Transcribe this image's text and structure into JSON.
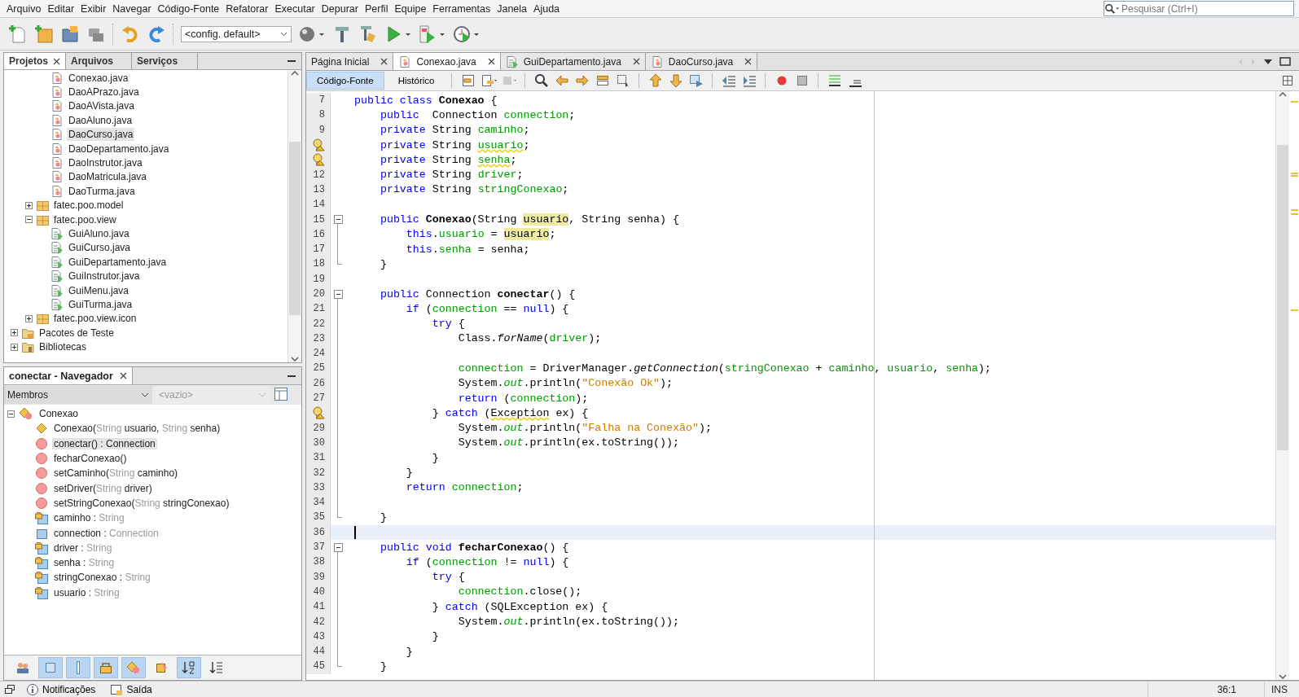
{
  "menu": [
    "Arquivo",
    "Editar",
    "Exibir",
    "Navegar",
    "Código-Fonte",
    "Refatorar",
    "Executar",
    "Depurar",
    "Perfil",
    "Equipe",
    "Ferramentas",
    "Janela",
    "Ajuda"
  ],
  "search": {
    "placeholder": "Pesquisar (Ctrl+I)"
  },
  "toolbar": {
    "configuration": "<config. default>"
  },
  "projects": {
    "tabs": [
      {
        "label": "Projetos",
        "selected": true
      },
      {
        "label": "Arquivos",
        "selected": false
      },
      {
        "label": "Serviços",
        "selected": false
      }
    ],
    "tree": [
      {
        "children": [
          {
            "children": [
              {
                "children": [
                  {
                    "label": "Conexao.java",
                    "kind": "class",
                    "selected": false
                  },
                  {
                    "label": "DaoAPrazo.java",
                    "kind": "class",
                    "selected": false
                  },
                  {
                    "label": "DaoAVista.java",
                    "kind": "class",
                    "selected": false
                  },
                  {
                    "label": "DaoAluno.java",
                    "kind": "class",
                    "selected": false
                  },
                  {
                    "label": "DaoCurso.java",
                    "kind": "class",
                    "selected": true
                  },
                  {
                    "label": "DaoDepartamento.java",
                    "kind": "class",
                    "selected": false
                  },
                  {
                    "label": "DaoInstrutor.java",
                    "kind": "class",
                    "selected": false
                  },
                  {
                    "label": "DaoMatricula.java",
                    "kind": "class",
                    "selected": false
                  },
                  {
                    "label": "DaoTurma.java",
                    "kind": "class",
                    "selected": false
                  }
                ]
              },
              {
                "label": "fatec.poo.model",
                "kind": "package",
                "expanded": false,
                "selected": false
              },
              {
                "label": "fatec.poo.view",
                "kind": "package",
                "expanded": true,
                "selected": false,
                "children": [
                  {
                    "label": "GuiAluno.java",
                    "kind": "form",
                    "selected": false
                  },
                  {
                    "label": "GuiCurso.java",
                    "kind": "form",
                    "selected": false
                  },
                  {
                    "label": "GuiDepartamento.java",
                    "kind": "form",
                    "selected": false
                  },
                  {
                    "label": "GuiInstrutor.java",
                    "kind": "form",
                    "selected": false
                  },
                  {
                    "label": "GuiMenu.java",
                    "kind": "form",
                    "selected": false
                  },
                  {
                    "label": "GuiTurma.java",
                    "kind": "form",
                    "selected": false
                  }
                ]
              },
              {
                "label": "fatec.poo.view.icon",
                "kind": "package",
                "expanded": false,
                "selected": false
              }
            ]
          },
          {
            "label": "Pacotes de Teste",
            "kind": "folder",
            "expanded": false,
            "selected": false
          },
          {
            "label": "Bibliotecas",
            "kind": "library",
            "expanded": false,
            "selected": false
          }
        ]
      }
    ]
  },
  "navigator": {
    "title": "conectar - Navegador",
    "view": "Membros",
    "filter_placeholder": "<vazio>",
    "root": {
      "label": "Conexao",
      "expanded": true,
      "members": [
        {
          "kind": "constructor",
          "selected": false,
          "segments": [
            {
              "kind": "name",
              "text": "Conexao("
            },
            {
              "kind": "type",
              "text": "String"
            },
            {
              "kind": "name",
              "text": " usuario, "
            },
            {
              "kind": "type",
              "text": "String"
            },
            {
              "kind": "name",
              "text": " senha)"
            }
          ]
        },
        {
          "kind": "method",
          "selected": true,
          "segments": [
            {
              "kind": "name",
              "text": "conectar() : Connection"
            }
          ]
        },
        {
          "kind": "method",
          "selected": false,
          "segments": [
            {
              "kind": "name",
              "text": "fecharConexao()"
            }
          ]
        },
        {
          "kind": "method",
          "selected": false,
          "segments": [
            {
              "kind": "name",
              "text": "setCaminho("
            },
            {
              "kind": "type",
              "text": "String"
            },
            {
              "kind": "name",
              "text": " caminho)"
            }
          ]
        },
        {
          "kind": "method",
          "selected": false,
          "segments": [
            {
              "kind": "name",
              "text": "setDriver("
            },
            {
              "kind": "type",
              "text": "String"
            },
            {
              "kind": "name",
              "text": " driver)"
            }
          ]
        },
        {
          "kind": "method",
          "selected": false,
          "segments": [
            {
              "kind": "name",
              "text": "setStringConexao("
            },
            {
              "kind": "type",
              "text": "String"
            },
            {
              "kind": "name",
              "text": " stringConexao)"
            }
          ]
        },
        {
          "kind": "private_field",
          "selected": false,
          "segments": [
            {
              "kind": "name",
              "text": "caminho : "
            },
            {
              "kind": "type",
              "text": "String"
            }
          ]
        },
        {
          "kind": "field",
          "selected": false,
          "segments": [
            {
              "kind": "name",
              "text": "connection : "
            },
            {
              "kind": "type",
              "text": "Connection"
            }
          ]
        },
        {
          "kind": "private_field",
          "selected": false,
          "segments": [
            {
              "kind": "name",
              "text": "driver : "
            },
            {
              "kind": "type",
              "text": "String"
            }
          ]
        },
        {
          "kind": "private_field",
          "selected": false,
          "segments": [
            {
              "kind": "name",
              "text": "senha : "
            },
            {
              "kind": "type",
              "text": "String"
            }
          ]
        },
        {
          "kind": "private_field",
          "selected": false,
          "segments": [
            {
              "kind": "name",
              "text": "stringConexao : "
            },
            {
              "kind": "type",
              "text": "String"
            }
          ]
        },
        {
          "kind": "private_field",
          "selected": false,
          "segments": [
            {
              "kind": "name",
              "text": "usuario : "
            },
            {
              "kind": "type",
              "text": "String"
            }
          ]
        }
      ]
    },
    "filters": [
      {
        "kind": "inherited",
        "selected": false
      },
      {
        "kind": "fields",
        "selected": true
      },
      {
        "kind": "static",
        "selected": true
      },
      {
        "kind": "nonpublic",
        "selected": true
      },
      {
        "kind": "inner",
        "selected": true
      },
      {
        "kind": "javadoc",
        "selected": false
      },
      {
        "kind": "sort_name",
        "selected": true
      },
      {
        "kind": "sort_source",
        "selected": false
      }
    ]
  },
  "editor": {
    "tabs": [
      {
        "label": "Página Inicial",
        "kind": "page",
        "selected": false
      },
      {
        "label": "Conexao.java",
        "kind": "class",
        "selected": true
      },
      {
        "label": "GuiDepartamento.java",
        "kind": "form",
        "selected": false
      },
      {
        "label": "DaoCurso.java",
        "kind": "class",
        "selected": false
      }
    ],
    "views": [
      {
        "label": "Código-Fonte",
        "selected": true
      },
      {
        "label": "Histórico",
        "selected": false
      }
    ],
    "lines": [
      {
        "number": "7",
        "kind": "plain",
        "warning": false,
        "current": false,
        "tokens": [
          {
            "kind": "kw",
            "text": "public class "
          },
          {
            "kind": "decl",
            "text": "Conexao"
          },
          {
            "kind": "plain",
            "text": " {"
          }
        ]
      },
      {
        "number": "8",
        "kind": "plain",
        "warning": false,
        "current": false,
        "tokens": [
          {
            "kind": "kw",
            "text": "    public "
          },
          {
            "kind": "plain",
            "text": " Connection "
          },
          {
            "kind": "field",
            "text": "connection"
          },
          {
            "kind": "plain",
            "text": ";"
          }
        ]
      },
      {
        "number": "9",
        "kind": "plain",
        "warning": false,
        "current": false,
        "tokens": [
          {
            "kind": "kw",
            "text": "    private "
          },
          {
            "kind": "plain",
            "text": "String "
          },
          {
            "kind": "field",
            "text": "caminho"
          },
          {
            "kind": "plain",
            "text": ";"
          }
        ]
      },
      {
        "kind": "plain",
        "warning": true,
        "current": false,
        "tokens": [
          {
            "kind": "kw",
            "text": "    private "
          },
          {
            "kind": "plain",
            "text": "String "
          },
          {
            "kind": "warn",
            "text": "usuario"
          },
          {
            "kind": "plain",
            "text": ";"
          }
        ]
      },
      {
        "kind": "plain",
        "warning": true,
        "current": false,
        "tokens": [
          {
            "kind": "kw",
            "text": "    private "
          },
          {
            "kind": "plain",
            "text": "String "
          },
          {
            "kind": "warn",
            "text": "senha"
          },
          {
            "kind": "plain",
            "text": ";"
          }
        ]
      },
      {
        "number": "12",
        "kind": "plain",
        "warning": false,
        "current": false,
        "tokens": [
          {
            "kind": "kw",
            "text": "    private "
          },
          {
            "kind": "plain",
            "text": "String "
          },
          {
            "kind": "field",
            "text": "driver"
          },
          {
            "kind": "plain",
            "text": ";"
          }
        ]
      },
      {
        "number": "13",
        "kind": "plain",
        "warning": false,
        "current": false,
        "tokens": [
          {
            "kind": "kw",
            "text": "    private "
          },
          {
            "kind": "plain",
            "text": "String "
          },
          {
            "kind": "field",
            "text": "stringConexao"
          },
          {
            "kind": "plain",
            "text": ";"
          }
        ]
      },
      {
        "number": "14",
        "kind": "plain",
        "warning": false,
        "current": false
      },
      {
        "number": "15",
        "kind": "fold_start",
        "warning": false,
        "current": false,
        "tokens": [
          {
            "kind": "kw",
            "text": "    public "
          },
          {
            "kind": "decl",
            "text": "Conexao"
          },
          {
            "kind": "plain",
            "text": "(String "
          },
          {
            "kind": "occurrence",
            "text": "usuario"
          },
          {
            "kind": "plain",
            "text": ", String senha) {"
          }
        ]
      },
      {
        "number": "16",
        "kind": "fold_body",
        "warning": false,
        "current": false,
        "tokens": [
          {
            "kind": "kw",
            "text": "        this"
          },
          {
            "kind": "plain",
            "text": "."
          },
          {
            "kind": "field",
            "text": "usuario"
          },
          {
            "kind": "plain",
            "text": " = "
          },
          {
            "kind": "occurrence",
            "text": "usuario"
          },
          {
            "kind": "plain",
            "text": ";"
          }
        ]
      },
      {
        "number": "17",
        "kind": "fold_body",
        "warning": false,
        "current": false,
        "tokens": [
          {
            "kind": "kw",
            "text": "        this"
          },
          {
            "kind": "plain",
            "text": "."
          },
          {
            "kind": "field",
            "text": "senha"
          },
          {
            "kind": "plain",
            "text": " = senha;"
          }
        ]
      },
      {
        "number": "18",
        "kind": "fold_end",
        "warning": false,
        "current": false,
        "tokens": [
          {
            "kind": "plain",
            "text": "    }"
          }
        ]
      },
      {
        "number": "19",
        "kind": "plain",
        "warning": false,
        "current": false
      },
      {
        "number": "20",
        "kind": "fold_start",
        "warning": false,
        "current": false,
        "tokens": [
          {
            "kind": "kw",
            "text": "    public "
          },
          {
            "kind": "plain",
            "text": "Connection "
          },
          {
            "kind": "decl",
            "text": "conectar"
          },
          {
            "kind": "plain",
            "text": "() {"
          }
        ]
      },
      {
        "number": "21",
        "kind": "fold_body",
        "warning": false,
        "current": false,
        "tokens": [
          {
            "kind": "kw",
            "text": "        if"
          },
          {
            "kind": "plain",
            "text": " ("
          },
          {
            "kind": "field",
            "text": "connection"
          },
          {
            "kind": "plain",
            "text": " == "
          },
          {
            "kind": "kw",
            "text": "null"
          },
          {
            "kind": "plain",
            "text": ") {"
          }
        ]
      },
      {
        "number": "22",
        "kind": "fold_body",
        "warning": false,
        "current": false,
        "tokens": [
          {
            "kind": "kw",
            "text": "            try"
          },
          {
            "kind": "plain",
            "text": " {"
          }
        ]
      },
      {
        "number": "23",
        "kind": "fold_body",
        "warning": false,
        "current": false,
        "tokens": [
          {
            "kind": "plain",
            "text": "                Class."
          },
          {
            "kind": "call",
            "text": "forName"
          },
          {
            "kind": "plain",
            "text": "("
          },
          {
            "kind": "field",
            "text": "driver"
          },
          {
            "kind": "plain",
            "text": ");"
          }
        ]
      },
      {
        "number": "24",
        "kind": "fold_body",
        "warning": false,
        "current": false
      },
      {
        "number": "25",
        "kind": "fold_body",
        "warning": false,
        "current": false,
        "tokens": [
          {
            "kind": "field",
            "text": "                connection"
          },
          {
            "kind": "plain",
            "text": " = DriverManager."
          },
          {
            "kind": "call",
            "text": "getConnection"
          },
          {
            "kind": "plain",
            "text": "("
          },
          {
            "kind": "field",
            "text": "stringConexao"
          },
          {
            "kind": "plain",
            "text": " + "
          },
          {
            "kind": "field",
            "text": "caminho"
          },
          {
            "kind": "plain",
            "text": ", "
          },
          {
            "kind": "field",
            "text": "usuario"
          },
          {
            "kind": "plain",
            "text": ", "
          },
          {
            "kind": "field",
            "text": "senha"
          },
          {
            "kind": "plain",
            "text": ");"
          }
        ]
      },
      {
        "number": "26",
        "kind": "fold_body",
        "warning": false,
        "current": false,
        "tokens": [
          {
            "kind": "plain",
            "text": "                System."
          },
          {
            "kind": "static",
            "text": "out"
          },
          {
            "kind": "plain",
            "text": ".println("
          },
          {
            "kind": "string",
            "text": "\"Conexão Ok\""
          },
          {
            "kind": "plain",
            "text": ");"
          }
        ]
      },
      {
        "number": "27",
        "kind": "fold_body",
        "warning": false,
        "current": false,
        "tokens": [
          {
            "kind": "kw",
            "text": "                return"
          },
          {
            "kind": "plain",
            "text": " ("
          },
          {
            "kind": "field",
            "text": "connection"
          },
          {
            "kind": "plain",
            "text": ");"
          }
        ]
      },
      {
        "kind": "fold_body",
        "warning": true,
        "current": false,
        "tokens": [
          {
            "kind": "plain",
            "text": "            } "
          },
          {
            "kind": "kw",
            "text": "catch"
          },
          {
            "kind": "plain",
            "text": " ("
          },
          {
            "kind": "warn",
            "text": "Exception"
          },
          {
            "kind": "plain",
            "text": " ex) {"
          }
        ]
      },
      {
        "number": "29",
        "kind": "fold_body",
        "warning": false,
        "current": false,
        "tokens": [
          {
            "kind": "plain",
            "text": "                System."
          },
          {
            "kind": "static",
            "text": "out"
          },
          {
            "kind": "plain",
            "text": ".println("
          },
          {
            "kind": "string",
            "text": "\"Falha na Conexão\""
          },
          {
            "kind": "plain",
            "text": ");"
          }
        ]
      },
      {
        "number": "30",
        "kind": "fold_body",
        "warning": false,
        "current": false,
        "tokens": [
          {
            "kind": "plain",
            "text": "                System."
          },
          {
            "kind": "static",
            "text": "out"
          },
          {
            "kind": "plain",
            "text": ".println(ex.toString());"
          }
        ]
      },
      {
        "number": "31",
        "kind": "fold_body",
        "warning": false,
        "current": false,
        "tokens": [
          {
            "kind": "plain",
            "text": "            }"
          }
        ]
      },
      {
        "number": "32",
        "kind": "fold_body",
        "warning": false,
        "current": false,
        "tokens": [
          {
            "kind": "plain",
            "text": "        }"
          }
        ]
      },
      {
        "number": "33",
        "kind": "fold_body",
        "warning": false,
        "current": false,
        "tokens": [
          {
            "kind": "kw",
            "text": "        return "
          },
          {
            "kind": "field",
            "text": "connection"
          },
          {
            "kind": "plain",
            "text": ";"
          }
        ]
      },
      {
        "number": "34",
        "kind": "fold_body",
        "warning": false,
        "current": false
      },
      {
        "number": "35",
        "kind": "fold_end",
        "warning": false,
        "current": false,
        "tokens": [
          {
            "kind": "plain",
            "text": "    }"
          }
        ]
      },
      {
        "number": "36",
        "kind": "plain",
        "warning": false,
        "current": true
      },
      {
        "number": "37",
        "kind": "fold_start",
        "warning": false,
        "current": false,
        "tokens": [
          {
            "kind": "kw",
            "text": "    public void "
          },
          {
            "kind": "decl",
            "text": "fecharConexao"
          },
          {
            "kind": "plain",
            "text": "() {"
          }
        ]
      },
      {
        "number": "38",
        "kind": "fold_body",
        "warning": false,
        "current": false,
        "tokens": [
          {
            "kind": "kw",
            "text": "        if"
          },
          {
            "kind": "plain",
            "text": " ("
          },
          {
            "kind": "field",
            "text": "connection"
          },
          {
            "kind": "plain",
            "text": " != "
          },
          {
            "kind": "kw",
            "text": "null"
          },
          {
            "kind": "plain",
            "text": ") {"
          }
        ]
      },
      {
        "number": "39",
        "kind": "fold_body",
        "warning": false,
        "current": false,
        "tokens": [
          {
            "kind": "kw",
            "text": "            try"
          },
          {
            "kind": "plain",
            "text": " {"
          }
        ]
      },
      {
        "number": "40",
        "kind": "fold_body",
        "warning": false,
        "current": false,
        "tokens": [
          {
            "kind": "field",
            "text": "                connection"
          },
          {
            "kind": "plain",
            "text": ".close();"
          }
        ]
      },
      {
        "number": "41",
        "kind": "fold_body",
        "warning": false,
        "current": false,
        "tokens": [
          {
            "kind": "plain",
            "text": "            } "
          },
          {
            "kind": "kw",
            "text": "catch"
          },
          {
            "kind": "plain",
            "text": " (SQLException ex) {"
          }
        ]
      },
      {
        "number": "42",
        "kind": "fold_body",
        "warning": false,
        "current": false,
        "tokens": [
          {
            "kind": "plain",
            "text": "                System."
          },
          {
            "kind": "static",
            "text": "out"
          },
          {
            "kind": "plain",
            "text": ".println(ex.toString());"
          }
        ]
      },
      {
        "number": "43",
        "kind": "fold_body",
        "warning": false,
        "current": false,
        "tokens": [
          {
            "kind": "plain",
            "text": "            }"
          }
        ]
      },
      {
        "number": "44",
        "kind": "fold_body",
        "warning": false,
        "current": false,
        "tokens": [
          {
            "kind": "plain",
            "text": "        }"
          }
        ]
      },
      {
        "number": "45",
        "kind": "fold_end",
        "warning": false,
        "current": false,
        "tokens": [
          {
            "kind": "plain",
            "text": "    }"
          }
        ]
      }
    ]
  },
  "status_bar": {
    "items": [
      {
        "label": "Notificações",
        "kind": "notifications"
      },
      {
        "label": "Saída",
        "kind": "output"
      }
    ],
    "position": "36:1",
    "mode": "INS"
  }
}
